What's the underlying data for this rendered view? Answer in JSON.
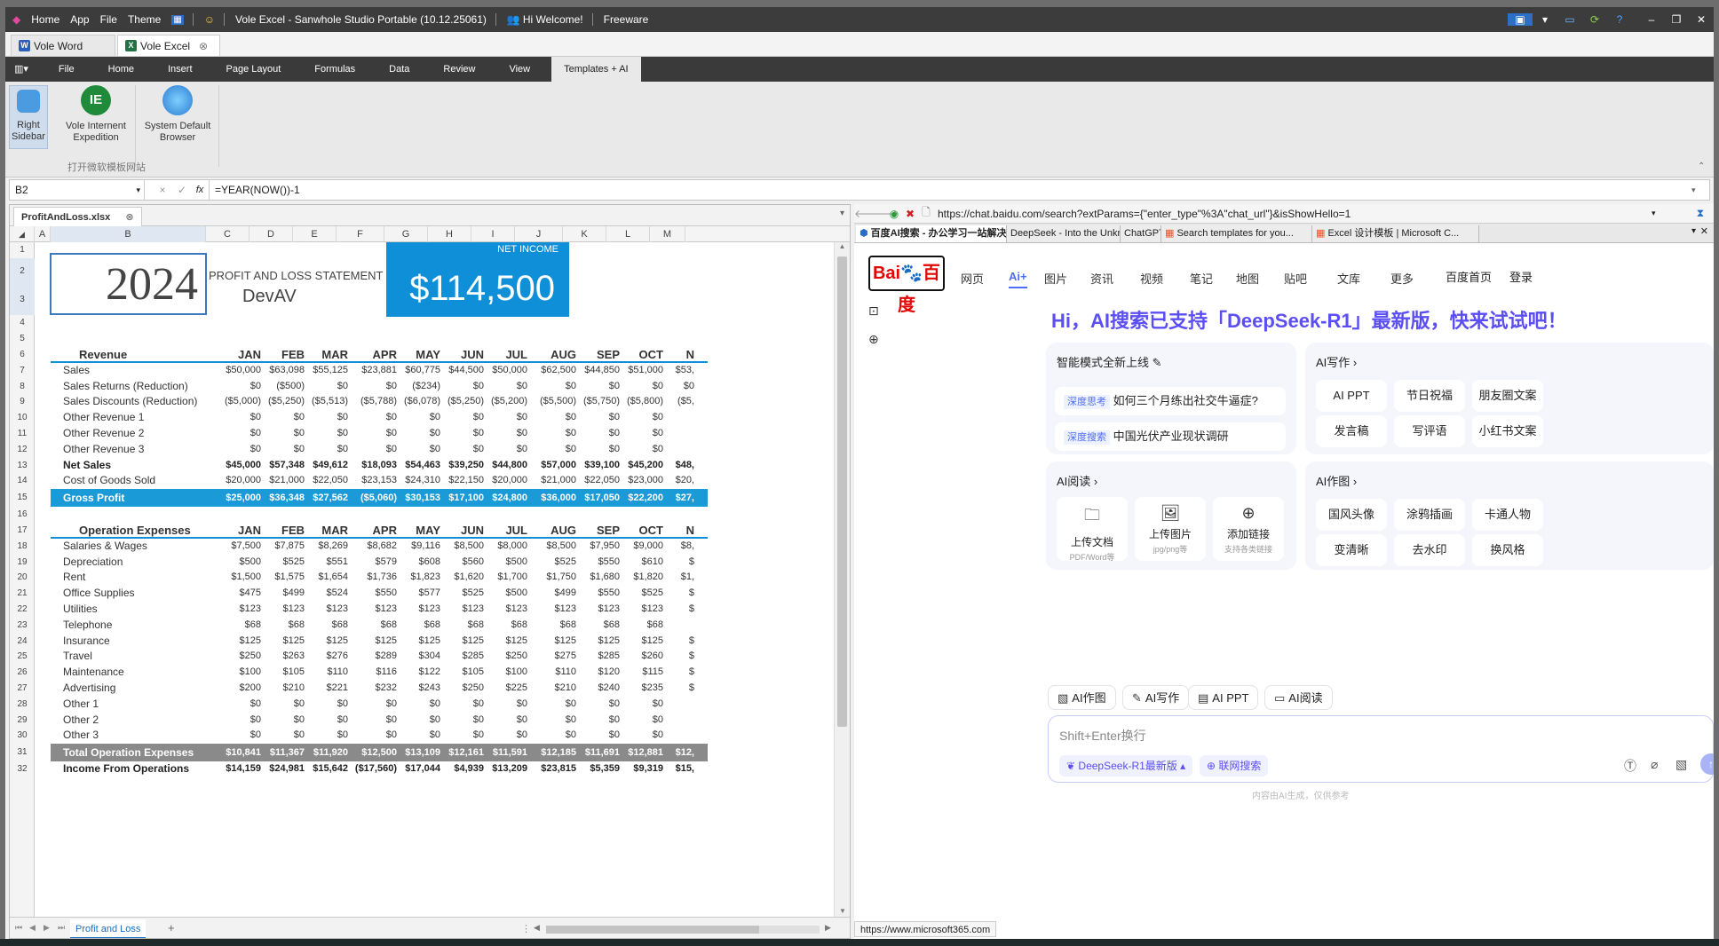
{
  "titlebar": {
    "menu": [
      "Home",
      "App",
      "File",
      "Theme"
    ],
    "title": "Vole Excel - Sanwhole Studio Portable (10.12.25061)",
    "welcome": "Hi Welcome!",
    "license": "Freeware"
  },
  "doctabs": [
    {
      "label": "Vole Word"
    },
    {
      "label": "Vole Excel"
    }
  ],
  "ribbon_tabs": [
    "File",
    "Home",
    "Insert",
    "Page Layout",
    "Formulas",
    "Data",
    "Review",
    "View",
    "Templates + AI"
  ],
  "ribbon_buttons": [
    {
      "label1": "Right",
      "label2": "Sidebar"
    },
    {
      "label1": "Vole Internent",
      "label2": "Expedition"
    },
    {
      "label1": "System Default",
      "label2": "Browser"
    }
  ],
  "ribbon_group": "打开微软模板网站",
  "formula": {
    "cell": "B2",
    "value": "=YEAR(NOW())-1"
  },
  "workbook": {
    "file": "ProfitAndLoss.xlsx",
    "sheet": "Profit and Loss",
    "add": "+"
  },
  "columns": [
    "A",
    "B",
    "C",
    "D",
    "E",
    "F",
    "G",
    "H",
    "I",
    "J",
    "K",
    "L",
    "M"
  ],
  "report": {
    "year": "2024",
    "title": "PROFIT AND LOSS STATEMENT",
    "company": "DevAV",
    "net_income_label": "NET INCOME",
    "net_income": "$114,500"
  },
  "months": [
    "JAN",
    "FEB",
    "MAR",
    "APR",
    "MAY",
    "JUN",
    "JUL",
    "AUG",
    "SEP",
    "OCT",
    "N"
  ],
  "revenue": {
    "header": "Revenue",
    "rows": [
      {
        "label": "Sales",
        "values": [
          "$50,000",
          "$63,098",
          "$55,125",
          "$23,881",
          "$60,775",
          "$44,500",
          "$50,000",
          "$62,500",
          "$44,850",
          "$51,000",
          "$53,"
        ]
      },
      {
        "label": "Sales Returns (Reduction)",
        "values": [
          "$0",
          "($500)",
          "$0",
          "$0",
          "($234)",
          "$0",
          "$0",
          "$0",
          "$0",
          "$0",
          "$0"
        ]
      },
      {
        "label": "Sales Discounts (Reduction)",
        "values": [
          "($5,000)",
          "($5,250)",
          "($5,513)",
          "($5,788)",
          "($6,078)",
          "($5,250)",
          "($5,200)",
          "($5,500)",
          "($5,750)",
          "($5,800)",
          "($5,"
        ]
      },
      {
        "label": "Other Revenue 1",
        "values": [
          "$0",
          "$0",
          "$0",
          "$0",
          "$0",
          "$0",
          "$0",
          "$0",
          "$0",
          "$0",
          ""
        ]
      },
      {
        "label": "Other Revenue 2",
        "values": [
          "$0",
          "$0",
          "$0",
          "$0",
          "$0",
          "$0",
          "$0",
          "$0",
          "$0",
          "$0",
          ""
        ]
      },
      {
        "label": "Other Revenue 3",
        "values": [
          "$0",
          "$0",
          "$0",
          "$0",
          "$0",
          "$0",
          "$0",
          "$0",
          "$0",
          "$0",
          ""
        ]
      }
    ],
    "net_sales": {
      "label": "Net Sales",
      "values": [
        "$45,000",
        "$57,348",
        "$49,612",
        "$18,093",
        "$54,463",
        "$39,250",
        "$44,800",
        "$57,000",
        "$39,100",
        "$45,200",
        "$48,"
      ]
    },
    "cogs": {
      "label": "Cost of Goods Sold",
      "values": [
        "$20,000",
        "$21,000",
        "$22,050",
        "$23,153",
        "$24,310",
        "$22,150",
        "$20,000",
        "$21,000",
        "$22,050",
        "$23,000",
        "$20,"
      ]
    },
    "gross_profit": {
      "label": "Gross Profit",
      "values": [
        "$25,000",
        "$36,348",
        "$27,562",
        "($5,060)",
        "$30,153",
        "$17,100",
        "$24,800",
        "$36,000",
        "$17,050",
        "$22,200",
        "$27,"
      ]
    }
  },
  "opex": {
    "header": "Operation Expenses",
    "rows": [
      {
        "label": "Salaries & Wages",
        "values": [
          "$7,500",
          "$7,875",
          "$8,269",
          "$8,682",
          "$9,116",
          "$8,500",
          "$8,000",
          "$8,500",
          "$7,950",
          "$9,000",
          "$8,"
        ]
      },
      {
        "label": "Depreciation",
        "values": [
          "$500",
          "$525",
          "$551",
          "$579",
          "$608",
          "$560",
          "$500",
          "$525",
          "$550",
          "$610",
          "$"
        ]
      },
      {
        "label": "Rent",
        "values": [
          "$1,500",
          "$1,575",
          "$1,654",
          "$1,736",
          "$1,823",
          "$1,620",
          "$1,700",
          "$1,750",
          "$1,680",
          "$1,820",
          "$1,"
        ]
      },
      {
        "label": "Office Supplies",
        "values": [
          "$475",
          "$499",
          "$524",
          "$550",
          "$577",
          "$525",
          "$500",
          "$499",
          "$550",
          "$525",
          "$"
        ]
      },
      {
        "label": "Utilities",
        "values": [
          "$123",
          "$123",
          "$123",
          "$123",
          "$123",
          "$123",
          "$123",
          "$123",
          "$123",
          "$123",
          "$"
        ]
      },
      {
        "label": "Telephone",
        "values": [
          "$68",
          "$68",
          "$68",
          "$68",
          "$68",
          "$68",
          "$68",
          "$68",
          "$68",
          "$68",
          ""
        ]
      },
      {
        "label": "Insurance",
        "values": [
          "$125",
          "$125",
          "$125",
          "$125",
          "$125",
          "$125",
          "$125",
          "$125",
          "$125",
          "$125",
          "$"
        ]
      },
      {
        "label": "Travel",
        "values": [
          "$250",
          "$263",
          "$276",
          "$289",
          "$304",
          "$285",
          "$250",
          "$275",
          "$285",
          "$260",
          "$"
        ]
      },
      {
        "label": "Maintenance",
        "values": [
          "$100",
          "$105",
          "$110",
          "$116",
          "$122",
          "$105",
          "$100",
          "$110",
          "$120",
          "$115",
          "$"
        ]
      },
      {
        "label": "Advertising",
        "values": [
          "$200",
          "$210",
          "$221",
          "$232",
          "$243",
          "$250",
          "$225",
          "$210",
          "$240",
          "$235",
          "$"
        ]
      },
      {
        "label": "Other 1",
        "values": [
          "$0",
          "$0",
          "$0",
          "$0",
          "$0",
          "$0",
          "$0",
          "$0",
          "$0",
          "$0",
          ""
        ]
      },
      {
        "label": "Other 2",
        "values": [
          "$0",
          "$0",
          "$0",
          "$0",
          "$0",
          "$0",
          "$0",
          "$0",
          "$0",
          "$0",
          ""
        ]
      },
      {
        "label": "Other 3",
        "values": [
          "$0",
          "$0",
          "$0",
          "$0",
          "$0",
          "$0",
          "$0",
          "$0",
          "$0",
          "$0",
          ""
        ]
      }
    ],
    "total": {
      "label": "Total Operation Expenses",
      "values": [
        "$10,841",
        "$11,367",
        "$11,920",
        "$12,500",
        "$13,109",
        "$12,161",
        "$11,591",
        "$12,185",
        "$11,691",
        "$12,881",
        "$12,"
      ]
    },
    "income": {
      "label": "Income From Operations",
      "values": [
        "$14,159",
        "$24,981",
        "$15,642",
        "($17,560)",
        "$17,044",
        "$4,939",
        "$13,209",
        "$23,815",
        "$5,359",
        "$9,319",
        "$15,"
      ]
    }
  },
  "browser": {
    "url": "https://chat.baidu.com/search?extParams={\"enter_type\"%3A\"chat_url\"}&isShowHello=1",
    "tabs": [
      "百度AI搜索 - 办公学习一站解决",
      "DeepSeek - Into the Unkn...",
      "ChatGPT",
      "Search templates for you...",
      "Excel 设计模板 | Microsoft C..."
    ],
    "status": "https://www.microsoft365.com"
  },
  "baidu": {
    "logo_a": "Bai",
    "logo_b": "百度",
    "nav": [
      "网页",
      "Ai+",
      "图片",
      "资讯",
      "视频",
      "笔记",
      "地图",
      "贴吧",
      "文库",
      "更多"
    ],
    "home": "百度首页",
    "login": "登录",
    "headline": "Hi，AI搜索已支持「DeepSeek-R1」最新版，快来试试吧！",
    "smart": {
      "title": "智能模式全新上线",
      "items": [
        {
          "tag": "深度思考",
          "text": "如何三个月练出社交牛逼症?"
        },
        {
          "tag": "深度搜索",
          "text": "中国光伏产业现状调研"
        }
      ]
    },
    "write": {
      "title": "AI写作 ›",
      "items": [
        "AI PPT",
        "节日祝福",
        "朋友圈文案",
        "发言稿",
        "写评语",
        "小红书文案"
      ]
    },
    "read": {
      "title": "AI阅读 ›",
      "items": [
        {
          "t": "上传文档",
          "s": "PDF/Word等"
        },
        {
          "t": "上传图片",
          "s": "jpg/png等"
        },
        {
          "t": "添加链接",
          "s": "支持各类链接"
        }
      ]
    },
    "draw": {
      "title": "AI作图 ›",
      "items": [
        "国风头像",
        "涂鸦插画",
        "卡通人物",
        "变清晰",
        "去水印",
        "换风格"
      ]
    },
    "chips": [
      "AI作图",
      "AI写作",
      "AI PPT",
      "AI阅读"
    ],
    "input_placeholder": "Shift+Enter换行",
    "model": "DeepSeek-R1最新版",
    "net": "联网搜索",
    "disclaimer": "内容由AI生成，仅供参考"
  },
  "colors": {
    "accent": "#0f8fd8",
    "grossbar": "#1a9ad6",
    "totalbar": "#8a8a8a",
    "baidu_blue": "#4e6ef2",
    "headline": "#5b4ef2"
  }
}
